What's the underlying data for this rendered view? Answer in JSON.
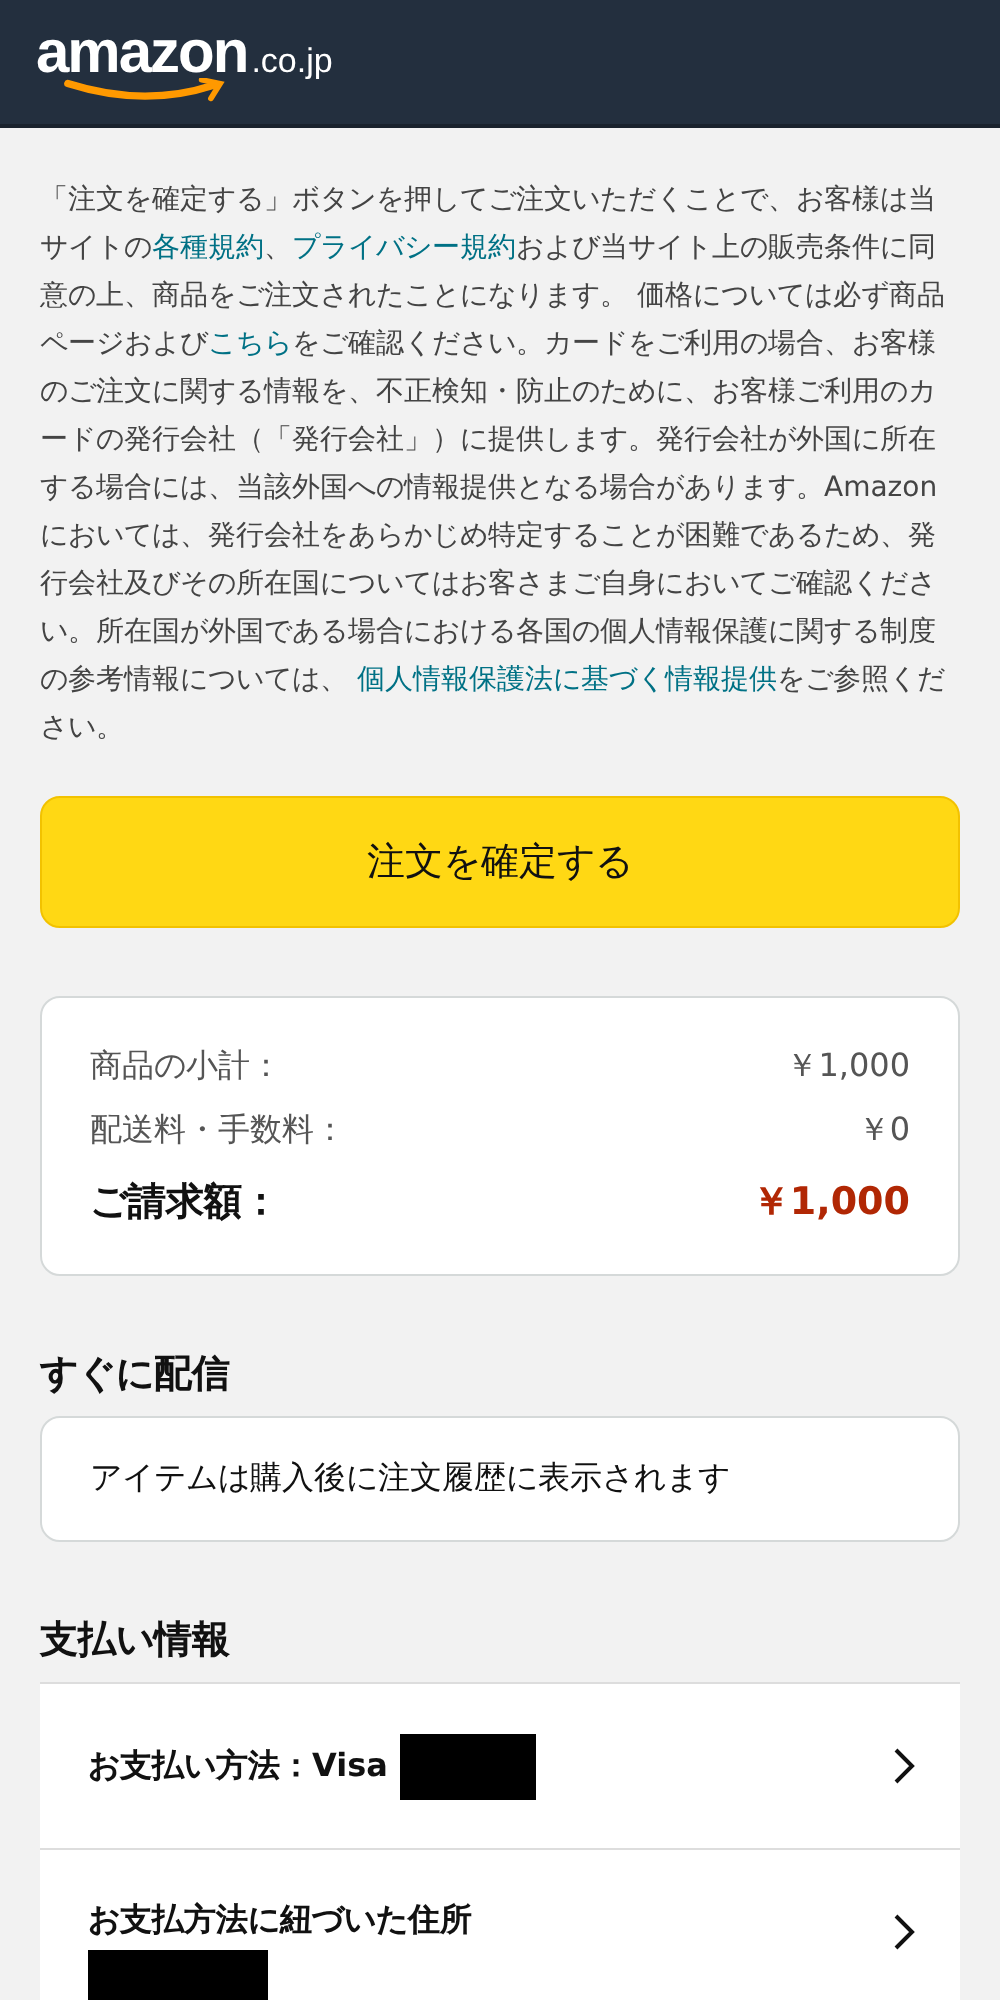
{
  "header": {
    "logo": "amazon",
    "logo_suffix": ".co.jp"
  },
  "notice": [
    {
      "kind": "text",
      "text": "「注文を確定する」ボタンを押してご注文いただくことで、お客様は当サイトの"
    },
    {
      "kind": "link",
      "text": "各種規約"
    },
    {
      "kind": "text",
      "text": "、"
    },
    {
      "kind": "link",
      "text": "プライバシー規約"
    },
    {
      "kind": "text",
      "text": "および当サイト上の販売条件に同意の上、商品をご注文されたことになります。 価格については必ず商品ページおよび"
    },
    {
      "kind": "link",
      "text": "こちら"
    },
    {
      "kind": "text",
      "text": "をご確認ください。カードをご利用の場合、お客様のご注文に関する情報を、不正検知・防止のために、お客様ご利用のカードの発行会社（「発行会社」）に提供します。発行会社が外国に所在する場合には、当該外国への情報提供となる場合があります。Amazonにおいては、発行会社をあらかじめ特定することが困難であるため、発行会社及びその所在国についてはお客さまご自身においてご確認ください。所在国が外国である場合における各国の個人情報保護に関する制度の参考情報については、 "
    },
    {
      "kind": "link",
      "text": "個人情報保護法に基づく情報提供"
    },
    {
      "kind": "text",
      "text": "をご参照ください。"
    }
  ],
  "confirm_button": "注文を確定する",
  "summary": [
    {
      "kind": "line",
      "label": "商品の小計：",
      "value": "￥1,000"
    },
    {
      "kind": "line",
      "label": "配送料・手数料：",
      "value": "￥0"
    },
    {
      "kind": "total",
      "label": "ご請求額：",
      "value": "￥1,000"
    }
  ],
  "delivery": {
    "heading": "すぐに配信",
    "message": "アイテムは購入後に注文履歴に表示されます"
  },
  "payment": {
    "heading": "支払い情報",
    "rows": [
      {
        "label": "お支払い方法：Visa",
        "redacted": true,
        "kind": "inline"
      },
      {
        "label": "お支払方法に紐づいた住所",
        "redacted": true,
        "kind": "below"
      }
    ]
  }
}
